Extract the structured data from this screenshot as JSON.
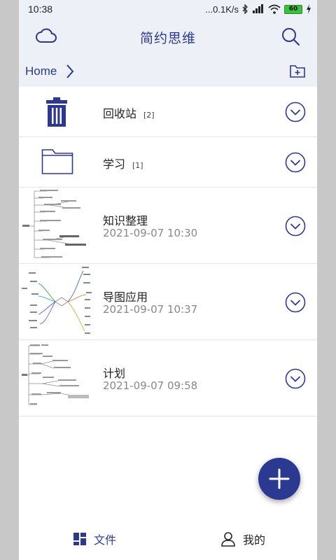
{
  "status": {
    "time": "10:38",
    "speed": "...0.1K/s",
    "battery": "60"
  },
  "app": {
    "title": "简约思维",
    "icons": {
      "left": "cloud-icon",
      "right": "search-icon"
    }
  },
  "breadcrumb": {
    "home": "Home",
    "action_icon": "new-folder-icon"
  },
  "colors": {
    "accent": "#2b3990",
    "top_bg": "#eef0f8",
    "muted": "#888888"
  },
  "folders": [
    {
      "title": "回收站",
      "count": "[2]",
      "icon": "trash-icon"
    },
    {
      "title": "学习",
      "count": "[1]",
      "icon": "folder-icon"
    }
  ],
  "files": [
    {
      "title": "知识整理",
      "date": "2021-09-07 10:30",
      "thumb": "mindmap-thumbnail"
    },
    {
      "title": "导图应用",
      "date": "2021-09-07 10:37",
      "thumb": "mindmap-thumbnail"
    },
    {
      "title": "计划",
      "date": "2021-09-07 09:58",
      "thumb": "mindmap-thumbnail"
    }
  ],
  "fab": {
    "icon": "plus-icon"
  },
  "nav": [
    {
      "label": "文件",
      "icon": "grid-icon",
      "active": true
    },
    {
      "label": "我的",
      "icon": "user-icon",
      "active": false
    }
  ]
}
